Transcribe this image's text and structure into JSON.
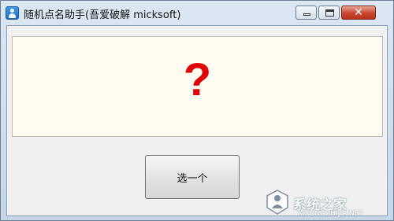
{
  "window": {
    "title": "随机点名助手(吾爱破解 micksoft)",
    "icon": "person-icon"
  },
  "caption_buttons": {
    "minimize_icon": "minimize-icon",
    "maximize_icon": "maximize-icon",
    "close_glyph": "✕"
  },
  "display": {
    "result_text": "?",
    "result_color": "#e00000"
  },
  "actions": {
    "pick_label": "选一个"
  },
  "watermark": {
    "text": "系统之家",
    "url": "XITONGZHIJIA.NET"
  }
}
